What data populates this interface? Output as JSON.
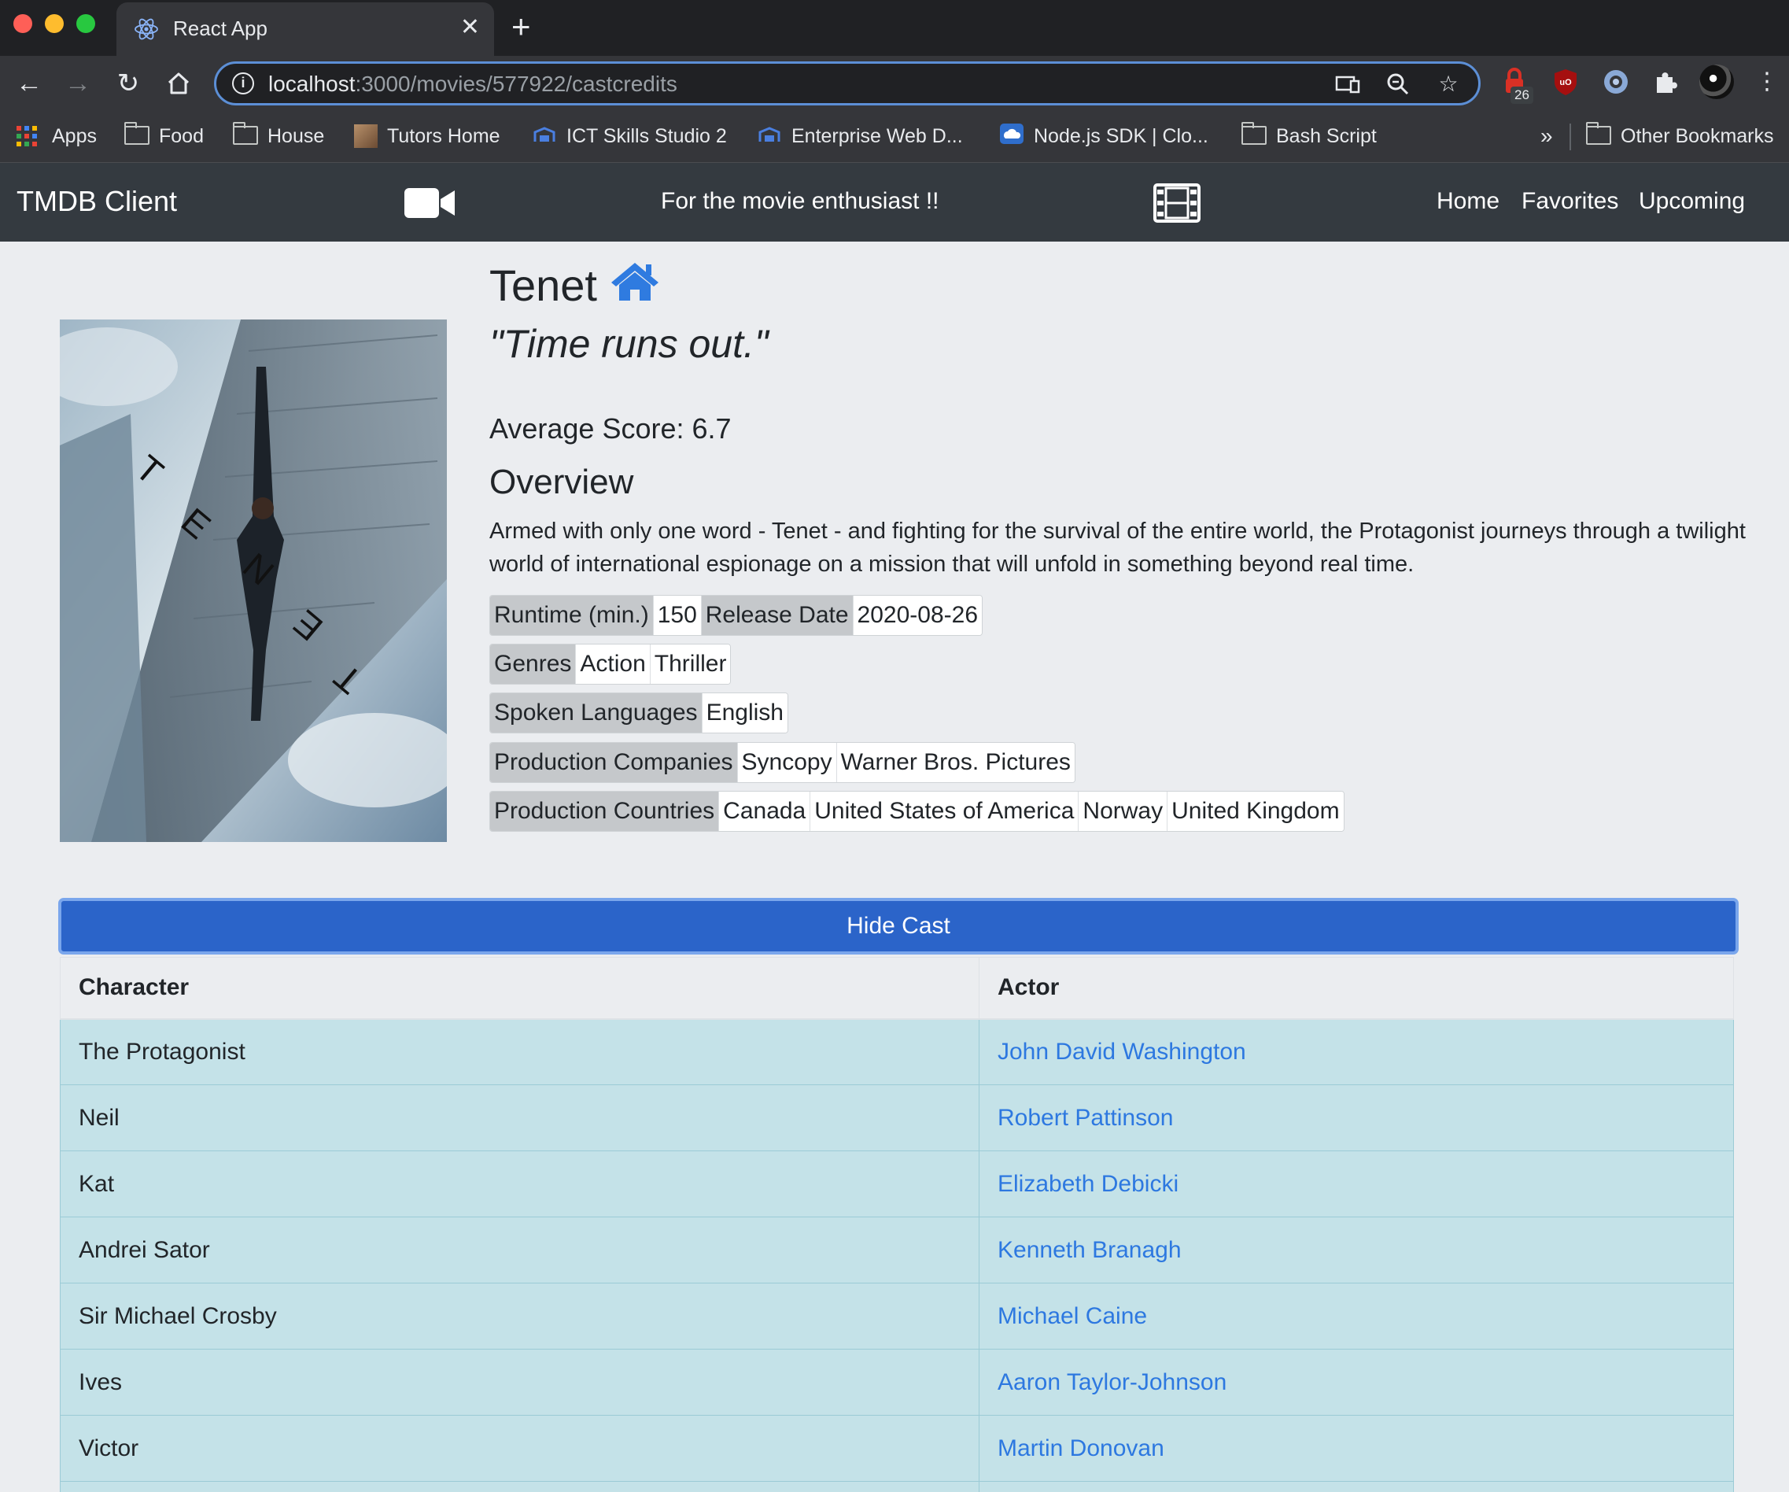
{
  "browser": {
    "tab_title": "React App",
    "url_host": "localhost",
    "url_path": ":3000/movies/577922/castcredits",
    "extension_badge": "26",
    "bookmarks": [
      {
        "label": "Apps",
        "icon": "apps-grid-icon"
      },
      {
        "label": "Food",
        "icon": "folder-icon"
      },
      {
        "label": "House",
        "icon": "folder-icon"
      },
      {
        "label": "Tutors Home",
        "icon": "tutors-favicon"
      },
      {
        "label": "ICT Skills Studio 2",
        "icon": "moodle-favicon"
      },
      {
        "label": "Enterprise Web D...",
        "icon": "moodle-favicon"
      },
      {
        "label": "Node.js SDK | Clo...",
        "icon": "cloud-favicon"
      },
      {
        "label": "Bash Script",
        "icon": "folder-icon"
      }
    ],
    "bookmarks_overflow": "»",
    "other_bookmarks": "Other Bookmarks"
  },
  "navbar": {
    "brand": "TMDB Client",
    "tagline": "For the movie enthusiast !!",
    "links": [
      "Home",
      "Favorites",
      "Upcoming"
    ]
  },
  "movie": {
    "title": "Tenet",
    "tagline": "\"Time runs out.\"",
    "average_score": "Average Score: 6.7",
    "overview_heading": "Overview",
    "overview": "Armed with only one word - Tenet - and fighting for the survival of the entire world, the Protagonist journeys through a twilight world of international espionage on a mission that will unfold in something beyond real time.",
    "poster_letters": [
      "T",
      "E",
      "N",
      "E",
      "T"
    ],
    "runtime_label": "Runtime (min.)",
    "runtime": "150",
    "release_label": "Release Date",
    "release_date": "2020-08-26",
    "genres_label": "Genres",
    "genres": [
      "Action",
      "Thriller"
    ],
    "languages_label": "Spoken Languages",
    "languages": [
      "English"
    ],
    "companies_label": "Production Companies",
    "companies": [
      "Syncopy",
      "Warner Bros. Pictures"
    ],
    "countries_label": "Production Countries",
    "countries": [
      "Canada",
      "United States of America",
      "Norway",
      "United Kingdom"
    ]
  },
  "cast": {
    "toggle_label": "Hide Cast",
    "headers": [
      "Character",
      "Actor"
    ],
    "rows": [
      {
        "character": "The Protagonist",
        "actor": "John David Washington"
      },
      {
        "character": "Neil",
        "actor": "Robert Pattinson"
      },
      {
        "character": "Kat",
        "actor": "Elizabeth Debicki"
      },
      {
        "character": "Andrei Sator",
        "actor": "Kenneth Branagh"
      },
      {
        "character": "Sir Michael Crosby",
        "actor": "Michael Caine"
      },
      {
        "character": "Ives",
        "actor": "Aaron Taylor-Johnson"
      },
      {
        "character": "Victor",
        "actor": "Martin Donovan"
      }
    ]
  },
  "colors": {
    "navbar_bg": "#343a40",
    "primary": "#2b64c9",
    "link": "#2d78e0",
    "table_row": "#c4e2e8",
    "home_icon": "#2f7be0"
  }
}
